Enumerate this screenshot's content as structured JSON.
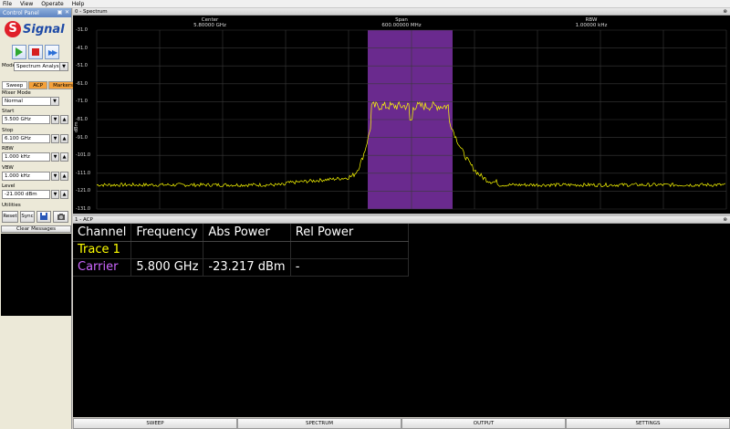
{
  "menu": [
    "File",
    "View",
    "Operate",
    "Help"
  ],
  "control_panel": {
    "title": "Control Panel",
    "logo_letter": "S",
    "logo_text": "Signal",
    "mode_label": "Mode",
    "mode_value": "Spectrum Analysis",
    "tabs": [
      "Sweep",
      "ACP",
      "Markers"
    ],
    "mixer_mode_label": "Mixer Mode",
    "mixer_mode_value": "Normal",
    "start_label": "Start",
    "start_value": "5.500 GHz",
    "stop_label": "Stop",
    "stop_value": "6.100 GHz",
    "rbw_label": "RBW",
    "rbw_value": "1.000 kHz",
    "vbw_label": "VBW",
    "vbw_value": "1.000 kHz",
    "level_label": "Level",
    "level_value": "-21.000 dBm",
    "utilities_label": "Utilities",
    "reset_label": "Reset",
    "sync_label": "Sync",
    "clear_messages_label": "Clear Messages"
  },
  "spectrum": {
    "title": "0 - Spectrum",
    "center_label": "Center",
    "center_value": "5.80000 GHz",
    "span_label": "Span",
    "span_value": "600.00000 MHz",
    "rbw_label": "RBW",
    "rbw_value": "1.00000 kHz",
    "y_unit": "dBm",
    "y_ticks": [
      "-31.0",
      "-41.0",
      "-51.0",
      "-61.0",
      "-71.0",
      "-81.0",
      "-91.0",
      "-101.0",
      "-111.0",
      "-121.0",
      "-131.0"
    ],
    "trace_color": "#ffff00",
    "channel_color": "#6a2a8e"
  },
  "acp": {
    "title": "1 - ACP",
    "columns": [
      "Channel",
      "Frequency",
      "Abs Power",
      "Rel Power"
    ],
    "rows": [
      {
        "channel": "Trace 1",
        "frequency": "",
        "abs_power": "",
        "rel_power": ""
      },
      {
        "channel": "Carrier",
        "frequency": "5.800 GHz",
        "abs_power": "-23.217 dBm",
        "rel_power": "-"
      }
    ],
    "trace_color": "#ffff00",
    "carrier_color": "#cc66ff"
  },
  "bottom_tabs": [
    "SWEEP",
    "SPECTRUM",
    "OUTPUT",
    "SETTINGS"
  ]
}
